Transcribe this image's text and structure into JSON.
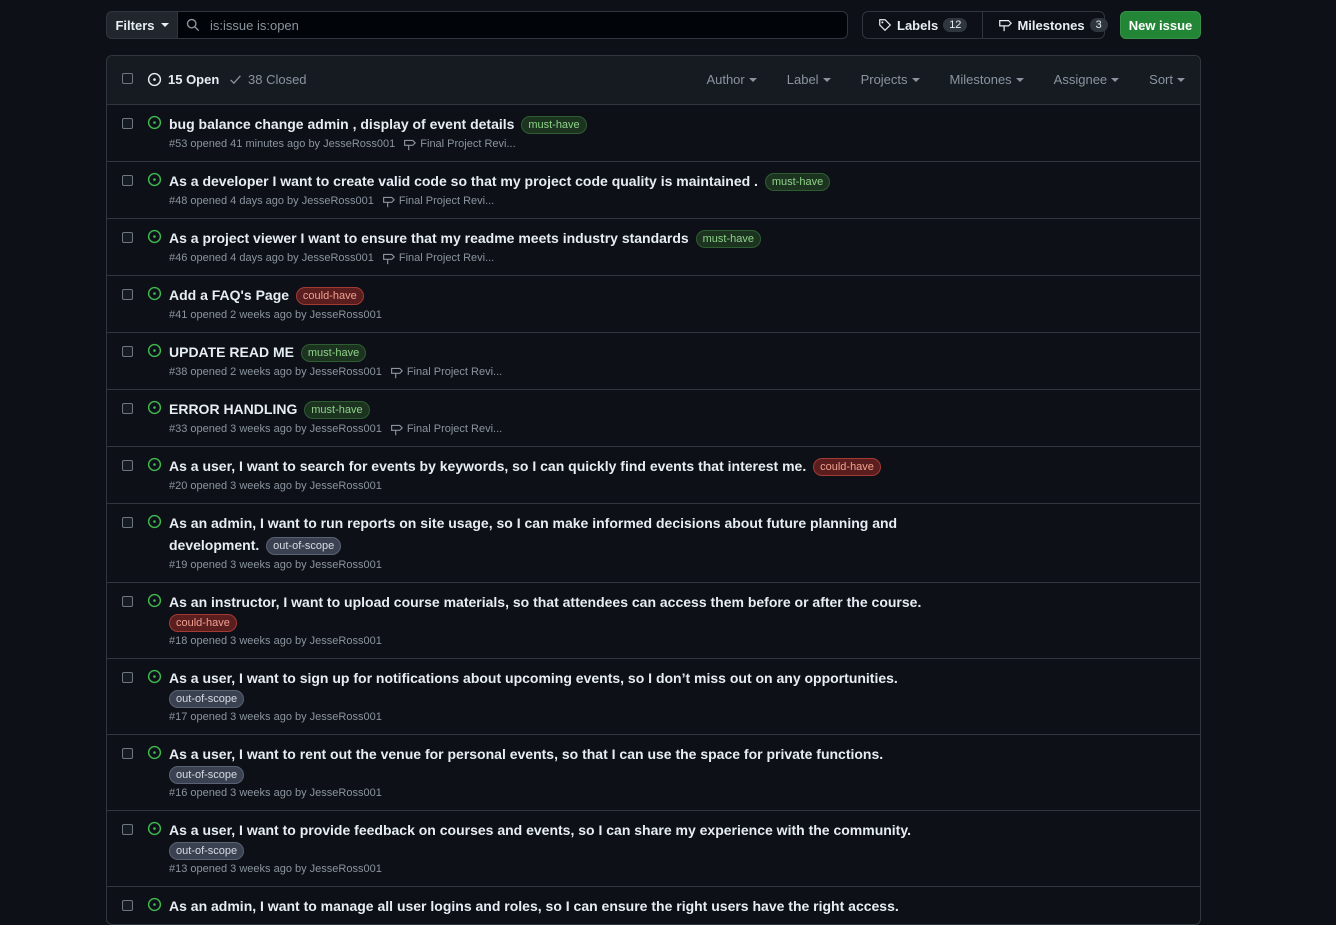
{
  "toolbar": {
    "filters_label": "Filters",
    "search_value": "is:issue is:open",
    "labels_label": "Labels",
    "labels_count": "12",
    "milestones_label": "Milestones",
    "milestones_count": "3",
    "new_issue_label": "New issue"
  },
  "header": {
    "open_label": "15 Open",
    "closed_label": "38 Closed",
    "menus": [
      "Author",
      "Label",
      "Projects",
      "Milestones",
      "Assignee",
      "Sort"
    ]
  },
  "colors": {
    "accent_green": "#238636",
    "open_icon": "#3fb950"
  },
  "issues": [
    {
      "title": "bug balance change admin , display of event details",
      "label": "must-have",
      "meta": "#53 opened 41 minutes ago by JesseRoss001",
      "milestone": "Final Project Revi..."
    },
    {
      "title": "As a developer I want to create valid code so that my project code quality is maintained .",
      "label": "must-have",
      "meta": "#48 opened 4 days ago by JesseRoss001",
      "milestone": "Final Project Revi..."
    },
    {
      "title": "As a project viewer I want to ensure that my readme meets industry standards",
      "label": "must-have",
      "meta": "#46 opened 4 days ago by JesseRoss001",
      "milestone": "Final Project Revi..."
    },
    {
      "title": "Add a FAQ's Page",
      "label": "could-have",
      "meta": "#41 opened 2 weeks ago by JesseRoss001",
      "milestone": ""
    },
    {
      "title": "UPDATE READ ME",
      "label": "must-have",
      "meta": "#38 opened 2 weeks ago by JesseRoss001",
      "milestone": "Final Project Revi..."
    },
    {
      "title": "ERROR HANDLING",
      "label": "must-have",
      "meta": "#33 opened 3 weeks ago by JesseRoss001",
      "milestone": "Final Project Revi..."
    },
    {
      "title": "As a user, I want to search for events by keywords, so I can quickly find events that interest me.",
      "label": "could-have",
      "meta": "#20 opened 3 weeks ago by JesseRoss001",
      "milestone": ""
    },
    {
      "title": "As an admin, I want to run reports on site usage, so I can make informed decisions about future planning and development.",
      "label": "out-of-scope",
      "meta": "#19 opened 3 weeks ago by JesseRoss001",
      "milestone": ""
    },
    {
      "title": "As an instructor, I want to upload course materials, so that attendees can access them before or after the course.",
      "label": "could-have",
      "meta": "#18 opened 3 weeks ago by JesseRoss001",
      "milestone": ""
    },
    {
      "title": "As a user, I want to sign up for notifications about upcoming events, so I don’t miss out on any opportunities.",
      "label": "out-of-scope",
      "meta": "#17 opened 3 weeks ago by JesseRoss001",
      "milestone": ""
    },
    {
      "title": "As a user, I want to rent out the venue for personal events, so that I can use the space for private functions.",
      "label": "out-of-scope",
      "meta": "#16 opened 3 weeks ago by JesseRoss001",
      "milestone": ""
    },
    {
      "title": "As a user, I want to provide feedback on courses and events, so I can share my experience with the community.",
      "label": "out-of-scope",
      "meta": "#13 opened 3 weeks ago by JesseRoss001",
      "milestone": ""
    },
    {
      "title": "As an admin, I want to manage all user logins and roles, so I can ensure the right users have the right access.",
      "label": "",
      "meta": "",
      "milestone": ""
    }
  ]
}
